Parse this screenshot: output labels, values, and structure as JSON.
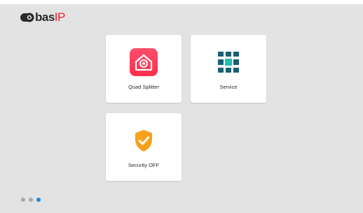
{
  "brand": {
    "logo_text_bas": "bas",
    "logo_text_ip": "IP",
    "accent_color": "#e8232a"
  },
  "tiles": [
    {
      "label": "Quad Splitter",
      "icon": "home-camera-icon",
      "color": "#ff4060"
    },
    {
      "label": "Service",
      "icon": "grid-apps-icon",
      "color": "#1b5f74"
    },
    {
      "label": "Security OFF",
      "icon": "shield-check-icon",
      "color": "#f7a21b"
    }
  ],
  "pagination": {
    "pages": 3,
    "active_page": 3,
    "active_color": "#1e88e5"
  }
}
